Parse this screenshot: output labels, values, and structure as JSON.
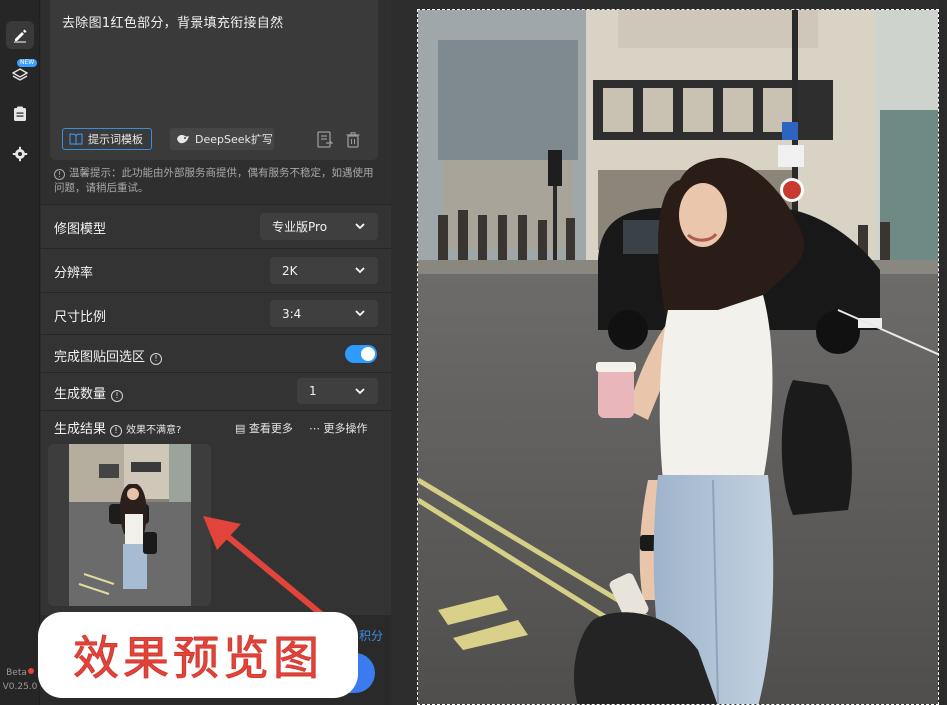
{
  "sidebar": {
    "new_badge": "NEW",
    "beta_label": "Beta",
    "version": "V0.25.0",
    "icons": [
      "edit-icon",
      "layers-icon",
      "clipboard-icon",
      "gear-icon"
    ]
  },
  "prompt": {
    "text": "去除图1红色部分，背景填充衔接自然",
    "template_button": "提示词模板",
    "deepseek_button": "DeepSeek扩写"
  },
  "notice": "温馨提示：此功能由外部服务商提供，偶有服务不稳定，如遇使用问题，请稍后重试。",
  "settings": {
    "model": {
      "label": "修图模型",
      "value": "专业版Pro"
    },
    "resolution": {
      "label": "分辨率",
      "value": "2K"
    },
    "aspect": {
      "label": "尺寸比例",
      "value": "3:4"
    },
    "paste_back": {
      "label": "完成图贴回选区",
      "enabled": true
    },
    "count": {
      "label": "生成数量",
      "value": "1"
    }
  },
  "results": {
    "title": "生成结果",
    "unsatisfied": "效果不满意?",
    "view_more": "查看更多",
    "more_actions": "更多操作"
  },
  "bottom": {
    "credits_suffix": "积分"
  },
  "annotation": {
    "text": "效果预览图"
  },
  "colors": {
    "accent": "#3a8dde",
    "toggle_on": "#2f9bff",
    "annotation_red": "#e0443a"
  }
}
